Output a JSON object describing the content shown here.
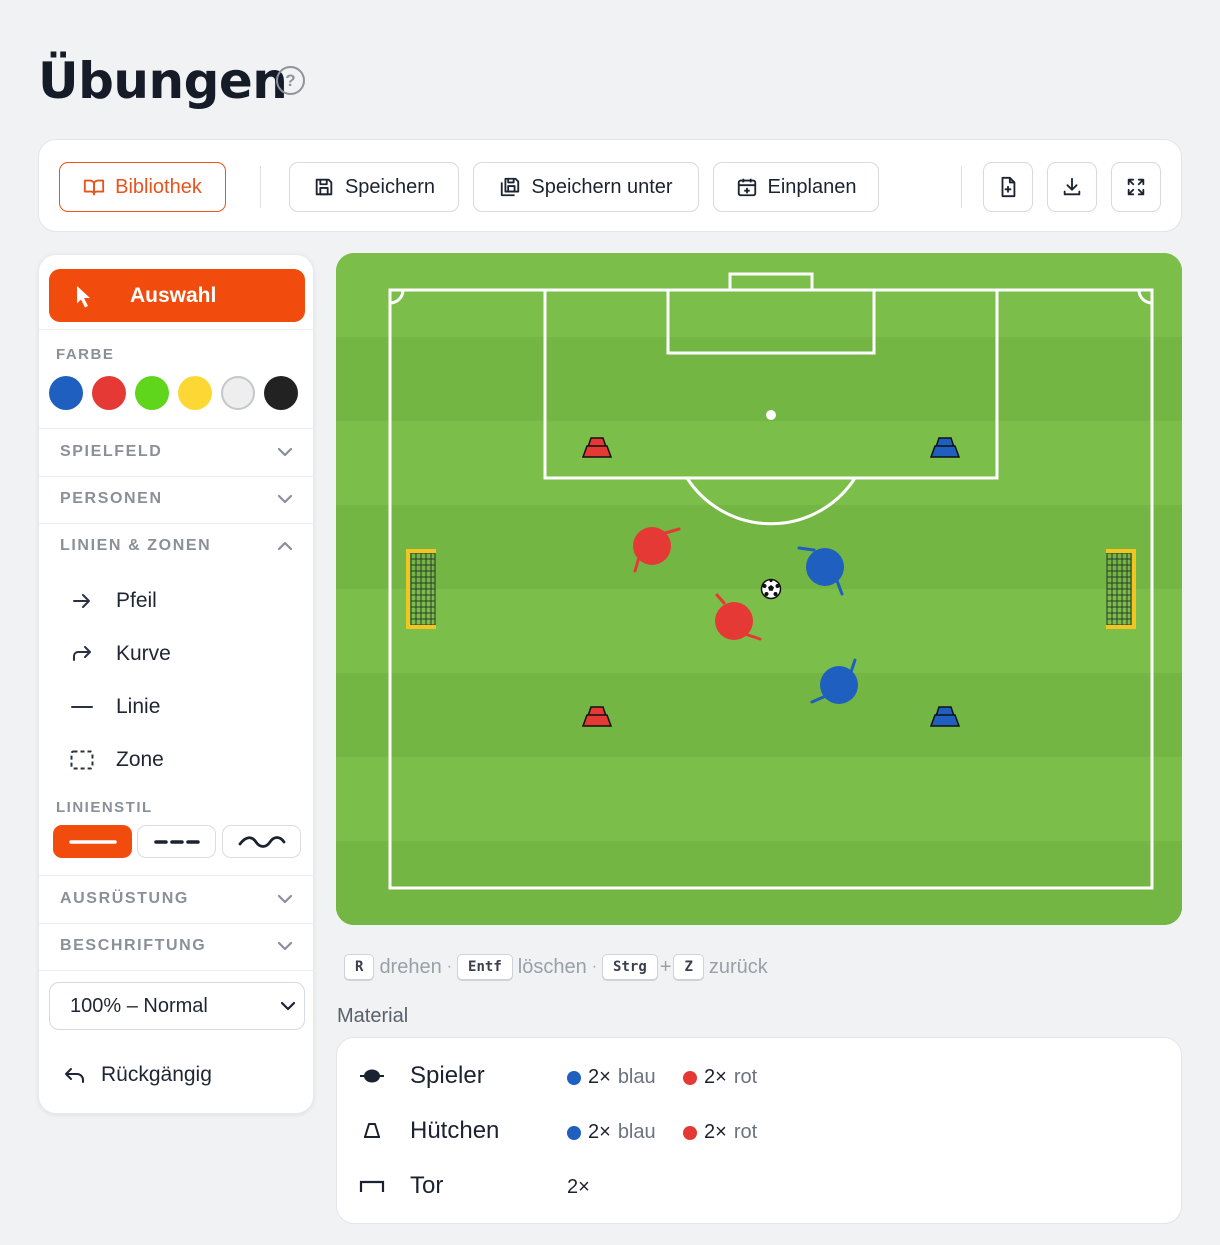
{
  "header": {
    "title": "Übungen",
    "help_icon": "question-circle-icon"
  },
  "toolbar": {
    "library": "Bibliothek",
    "save": "Speichern",
    "save_as": "Speichern unter",
    "schedule": "Einplanen",
    "icons": [
      "book-icon",
      "save-icon",
      "save-as-icon",
      "calendar-plus-icon",
      "new-file-icon",
      "download-icon",
      "fullscreen-icon"
    ]
  },
  "sidebar": {
    "select_tool": "Auswahl",
    "color_label": "FARBE",
    "colors": [
      "#1f5fbf",
      "#e53935",
      "#5fd51c",
      "#fdd835",
      "#eeeeee",
      "#222222"
    ],
    "sections": {
      "field": "SPIELFELD",
      "persons": "PERSONEN",
      "lines_zones": "LINIEN & ZONEN",
      "equipment": "AUSRÜSTUNG",
      "labels": "BESCHRIFTUNG"
    },
    "tools": {
      "arrow": "Pfeil",
      "curve": "Kurve",
      "line": "Linie",
      "zone": "Zone"
    },
    "line_style_label": "LINIENSTIL",
    "line_styles": [
      "solid",
      "dashed",
      "wavy"
    ],
    "active_line_style": "solid",
    "zoom": "100% – Normal",
    "undo": "Rückgängig"
  },
  "pitch": {
    "grass_light": "#7bbf4a",
    "grass_dark": "#73b644",
    "goals": 2,
    "players": [
      {
        "team": "red"
      },
      {
        "team": "red"
      },
      {
        "team": "blue"
      },
      {
        "team": "blue"
      }
    ],
    "cones": [
      {
        "color": "red"
      },
      {
        "color": "blue"
      },
      {
        "color": "red"
      },
      {
        "color": "blue"
      }
    ],
    "ball": 1
  },
  "hints": {
    "rotate_key": "R",
    "rotate": "drehen",
    "sep": "·",
    "delete_key": "Entf",
    "delete": "löschen",
    "ctrl_key": "Strg",
    "plus": "+",
    "z_key": "Z",
    "undo": "zurück"
  },
  "material": {
    "label": "Material",
    "rows": [
      {
        "name": "Spieler",
        "icon": "player-icon",
        "blue_count": "2×",
        "blue": "blau",
        "red_count": "2×",
        "red": "rot"
      },
      {
        "name": "Hütchen",
        "icon": "cone-icon",
        "blue_count": "2×",
        "blue": "blau",
        "red_count": "2×",
        "red": "rot"
      },
      {
        "name": "Tor",
        "icon": "goal-icon",
        "count": "2×"
      }
    ],
    "blue_color": "#1f5fbf",
    "red_color": "#e53935"
  }
}
